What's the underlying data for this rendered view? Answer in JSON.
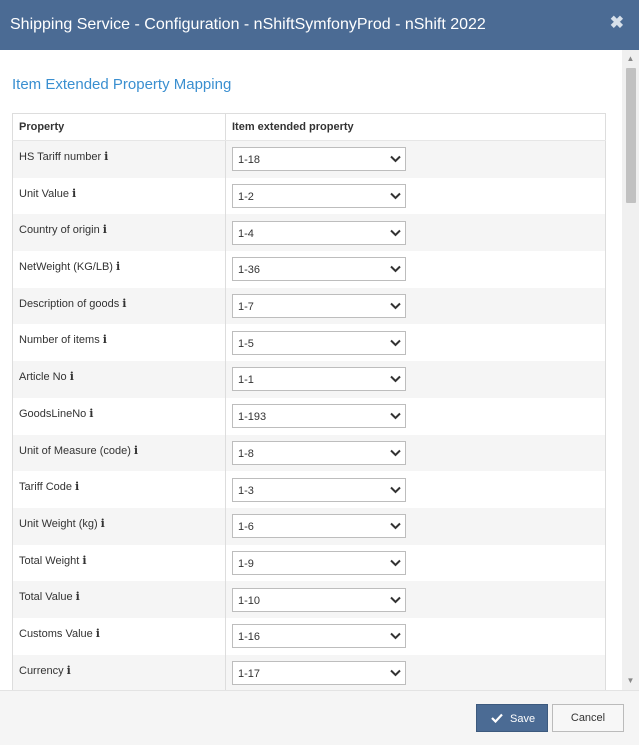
{
  "dialog": {
    "title": "Shipping Service - Configuration - nShiftSymfonyProd - nShift 2022",
    "close_glyph": "✖"
  },
  "section": {
    "title": "Item Extended Property Mapping"
  },
  "table": {
    "headers": [
      "Property",
      "Item extended property"
    ],
    "rows": [
      {
        "property": "HS Tariff number",
        "value": "1-18"
      },
      {
        "property": "Unit Value",
        "value": "1-2"
      },
      {
        "property": "Country of origin",
        "value": "1-4"
      },
      {
        "property": "NetWeight (KG/LB)",
        "value": "1-36"
      },
      {
        "property": "Description of goods",
        "value": "1-7"
      },
      {
        "property": "Number of items",
        "value": "1-5"
      },
      {
        "property": "Article No",
        "value": "1-1"
      },
      {
        "property": "GoodsLineNo",
        "value": "1-193"
      },
      {
        "property": "Unit of Measure (code)",
        "value": "1-8"
      },
      {
        "property": "Tariff Code",
        "value": "1-3"
      },
      {
        "property": "Unit Weight (kg)",
        "value": "1-6"
      },
      {
        "property": "Total Weight",
        "value": "1-9"
      },
      {
        "property": "Total Value",
        "value": "1-10"
      },
      {
        "property": "Customs Value",
        "value": "1-16"
      },
      {
        "property": "Currency",
        "value": "1-17"
      }
    ]
  },
  "footer": {
    "save_label": "Save",
    "cancel_label": "Cancel"
  },
  "icons": {
    "info": "info-icon",
    "dropdown": "chevron-down-icon",
    "save": "check-icon",
    "close": "close-icon"
  },
  "colors": {
    "titlebar": "#4b6b94",
    "section_title": "#3a8fd0",
    "save_button": "#4b6b94"
  }
}
